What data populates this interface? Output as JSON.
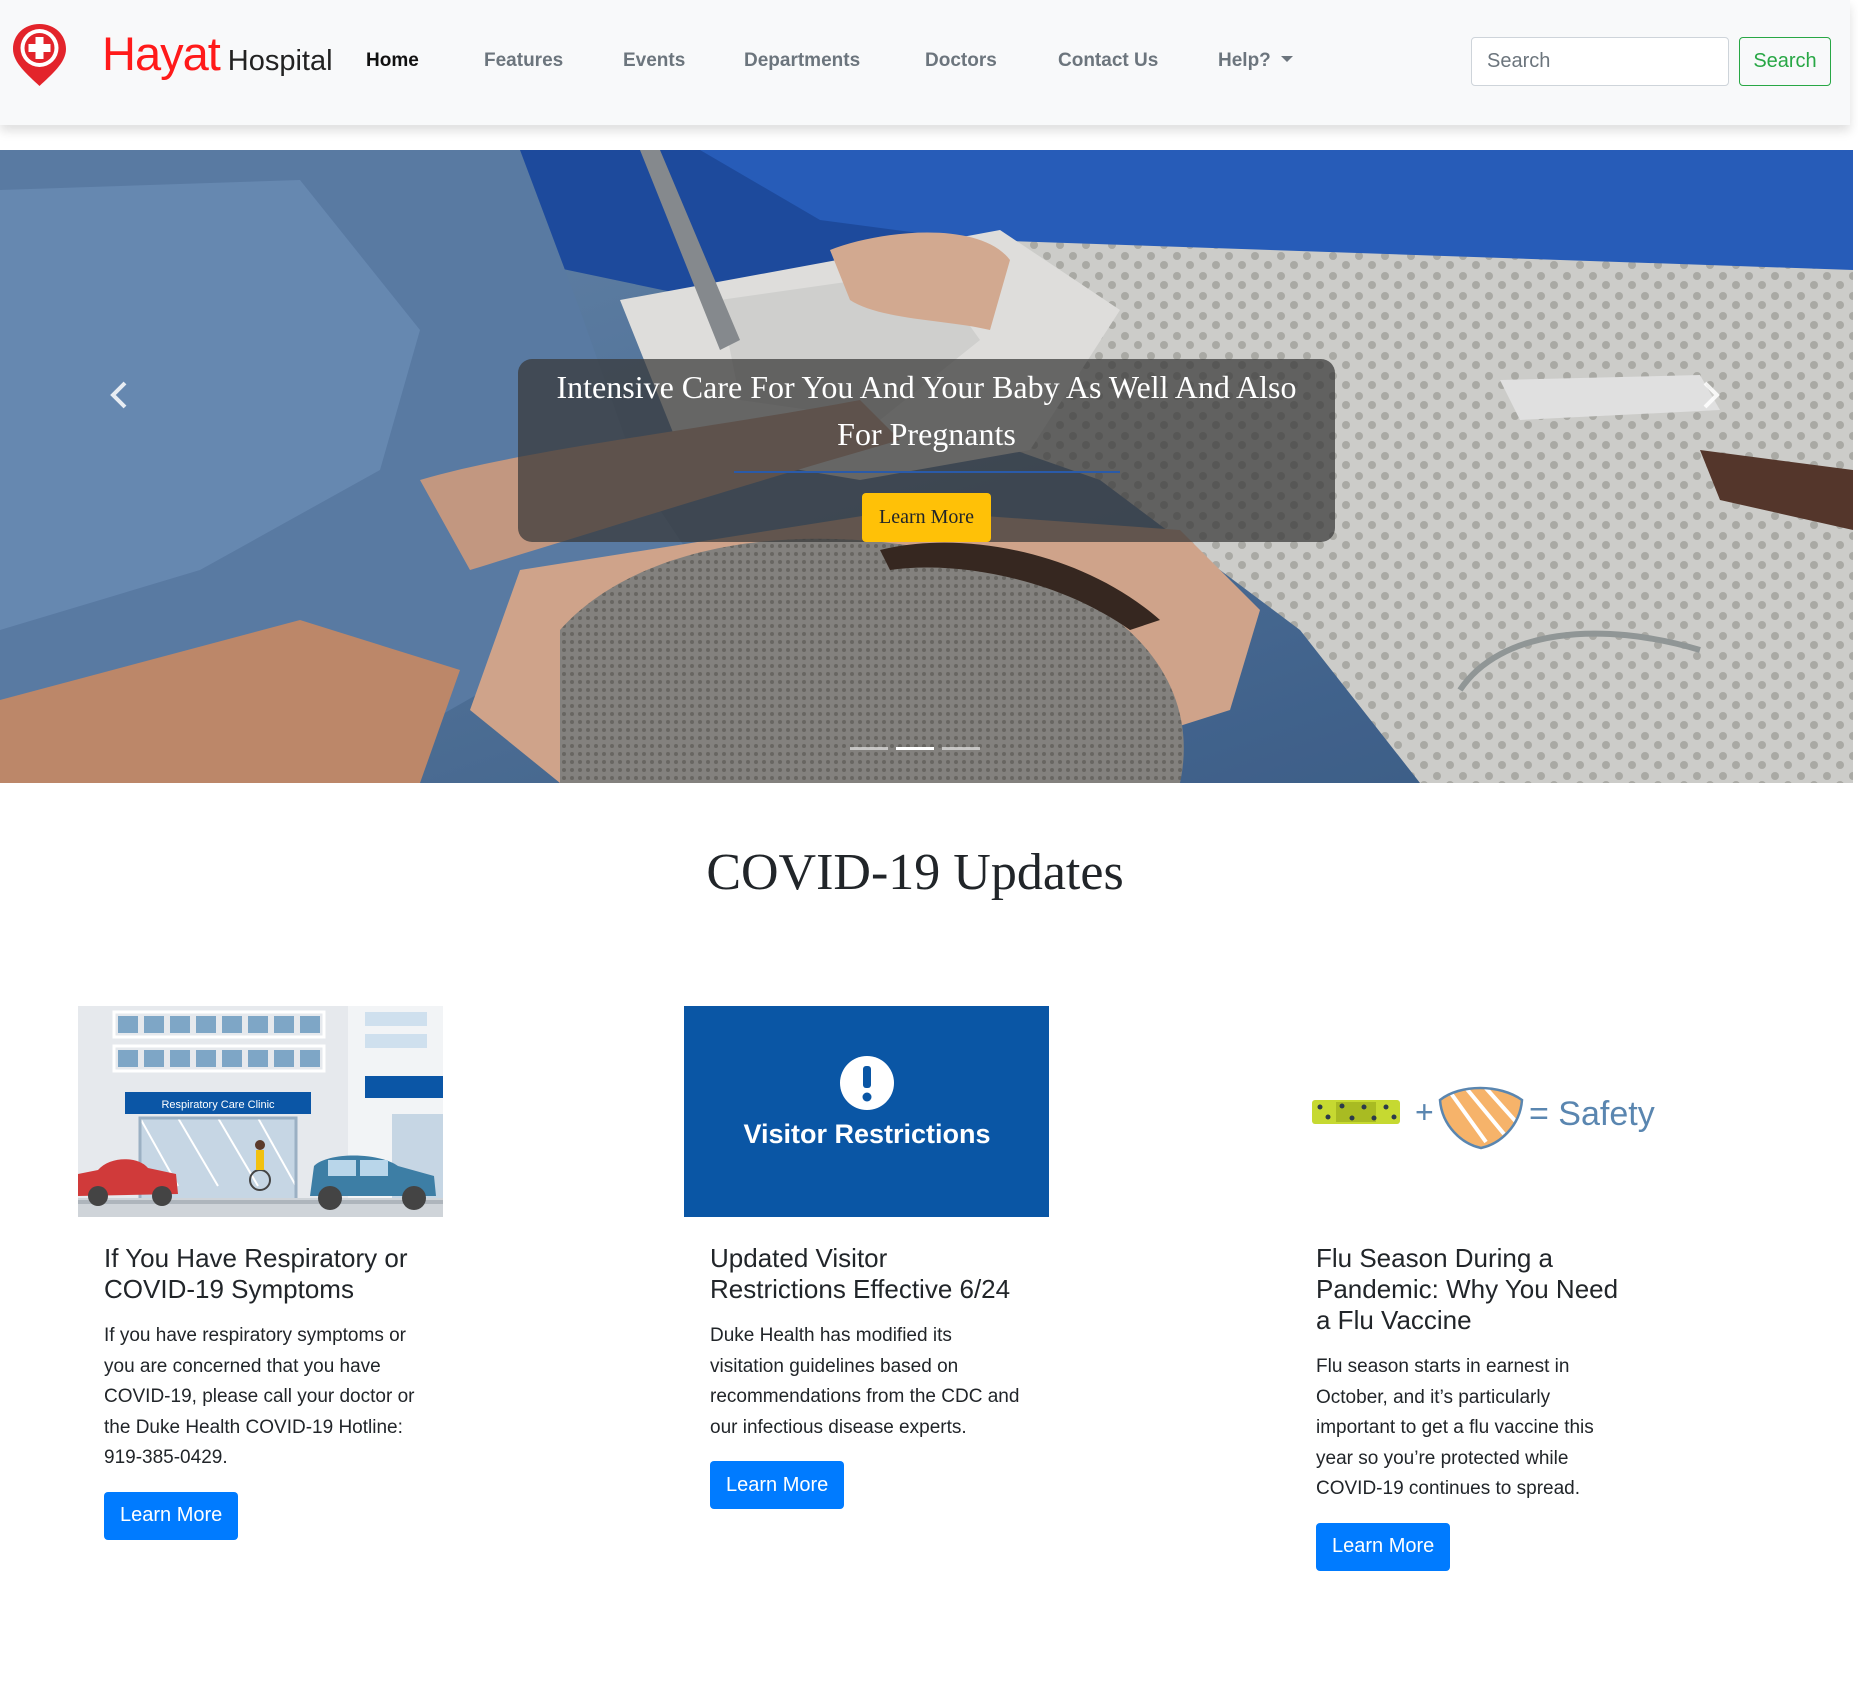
{
  "brand": {
    "name_primary": "Hayat",
    "name_secondary": "Hospital",
    "primary_color": "#ff1a1a"
  },
  "nav": {
    "items": [
      {
        "label": "Home",
        "active": true
      },
      {
        "label": "Features"
      },
      {
        "label": "Events"
      },
      {
        "label": "Departments"
      },
      {
        "label": "Doctors"
      },
      {
        "label": "Contact Us"
      },
      {
        "label": "Help?",
        "dropdown": true
      }
    ],
    "search_placeholder": "Search",
    "search_button": "Search"
  },
  "carousel": {
    "caption_title": "Intensive Care For You And Your Baby As Well And Also For Pregnants",
    "caption_button": "Learn More",
    "slide_count": 3,
    "active_slide": 2,
    "prev_icon": "chevron-left-icon",
    "next_icon": "chevron-right-icon"
  },
  "section": {
    "title": "COVID-19 Updates"
  },
  "cards": [
    {
      "image_sign": "Respiratory Care Clinic",
      "title": "If You Have Respiratory or COVID-19 Symptoms",
      "text": "If you have respiratory symptoms or you are concerned that you have COVID-19, please call your doctor or the Duke Health COVID-19 Hotline: 919-385-0429.",
      "button": "Learn More"
    },
    {
      "image_text": "Visitor Restrictions",
      "title": "Updated Visitor Restrictions Effective 6/24",
      "text": "Duke Health has modified its visitation guidelines based on recommendations from the CDC and our infectious disease experts.",
      "button": "Learn More"
    },
    {
      "image_text": "= Safety",
      "title": "Flu Season During a Pandemic: Why You Need a Flu Vaccine",
      "text": "Flu season starts in earnest in October, and it’s particularly important to get a flu vaccine this year so you’re protected while COVID-19 continues to spread.",
      "button": "Learn More"
    }
  ],
  "colors": {
    "primary_button": "#007bff",
    "caption_button": "#ffc107",
    "search_outline": "#28a745",
    "notice_blue": "#0a56a5"
  }
}
